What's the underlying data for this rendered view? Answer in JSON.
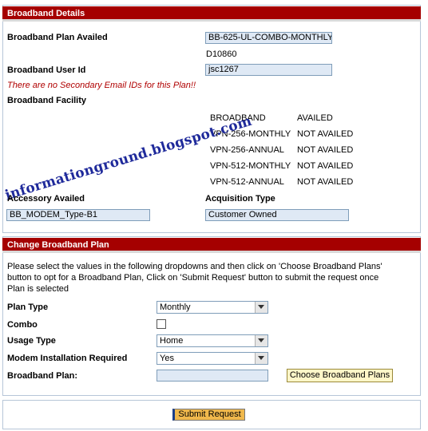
{
  "broadband_details": {
    "header": "Broadband Details",
    "plan_availed_label": "Broadband Plan Availed",
    "plan_availed_value": "BB-625-UL-COMBO-MONTHLY",
    "plan_code": "D10860",
    "user_id_label": "Broadband User Id",
    "user_id_value": "jsc1267",
    "error_message": "There are no Secondary Email IDs for this Plan!!",
    "facility_label": "Broadband Facility",
    "facilities": [
      {
        "name": "BROADBAND",
        "status": "AVAILED"
      },
      {
        "name": "VPN-256-MONTHLY",
        "status": "NOT AVAILED"
      },
      {
        "name": "VPN-256-ANNUAL",
        "status": "NOT AVAILED"
      },
      {
        "name": "VPN-512-MONTHLY",
        "status": "NOT AVAILED"
      },
      {
        "name": "VPN-512-ANNUAL",
        "status": "NOT AVAILED"
      }
    ],
    "accessory_label": "Accessory Availed",
    "accessory_value": "BB_MODEM_Type-B1",
    "acquisition_label": "Acquisition Type",
    "acquisition_value": "Customer Owned"
  },
  "watermark": "informationground.blogspot.com",
  "change_plan": {
    "header": "Change Broadband Plan",
    "instructions": "Please select the values in the following dropdowns and then click on 'Choose Broadband Plans' button to opt for a Broadband Plan, Click on 'Submit Request' button to submit the request once Plan is selected",
    "plan_type_label": "Plan Type",
    "plan_type_value": "Monthly",
    "combo_label": "Combo",
    "usage_type_label": "Usage Type",
    "usage_type_value": "Home",
    "modem_label": "Modem Installation Required",
    "modem_value": "Yes",
    "broadband_plan_label": "Broadband Plan:",
    "choose_button": "Choose Broadband Plans"
  },
  "submit_button": "Submit Request"
}
